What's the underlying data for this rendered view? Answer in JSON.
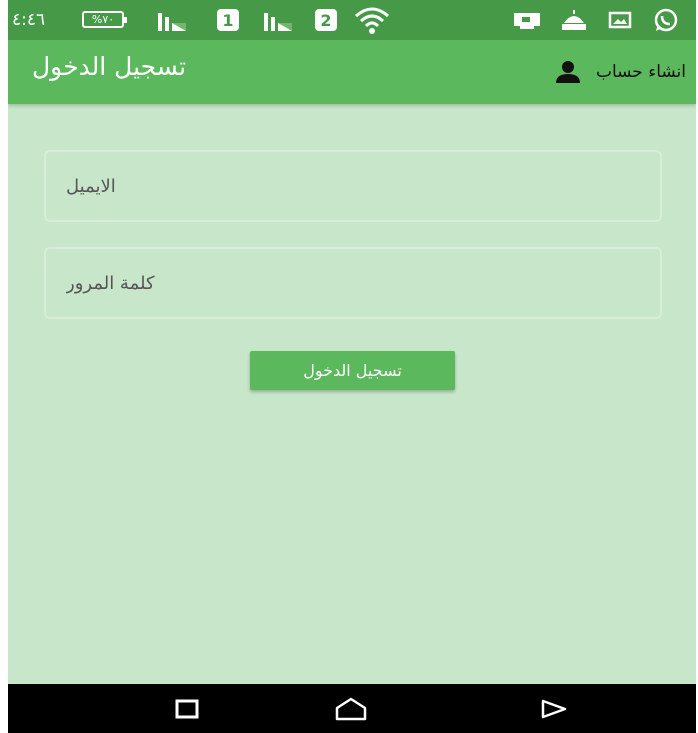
{
  "status_bar": {
    "time": "٤:٤٦",
    "battery": "%٧٠",
    "sim1": "2",
    "sim2": "1"
  },
  "app_bar": {
    "title": "تسجيل الدخول",
    "create_account": "انشاء حساب",
    "icon": "person-icon"
  },
  "form": {
    "email_placeholder": "الايميل",
    "email_value": "",
    "password_placeholder": "كلمة المرور",
    "password_value": "",
    "login_label": "تسجيل الدخول"
  },
  "nav_bar": {
    "icons": [
      "recents-icon",
      "home-icon",
      "back-icon"
    ]
  },
  "colors": {
    "status_bar": "#469a47",
    "app_bar": "#5cb85c",
    "background": "#c8e6c9",
    "button": "#5cb85c"
  }
}
